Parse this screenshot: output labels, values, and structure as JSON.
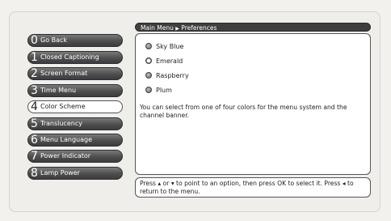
{
  "menu": {
    "items": [
      {
        "num": "0",
        "label": "Go Back",
        "selected": false
      },
      {
        "num": "1",
        "label": "Closed Captioning",
        "selected": false
      },
      {
        "num": "2",
        "label": "Screen Format",
        "selected": false
      },
      {
        "num": "3",
        "label": "Time Menu",
        "selected": false
      },
      {
        "num": "4",
        "label": "Color Scheme",
        "selected": true
      },
      {
        "num": "5",
        "label": "Translucency",
        "selected": false
      },
      {
        "num": "6",
        "label": "Menu Language",
        "selected": false
      },
      {
        "num": "7",
        "label": "Power Indicator",
        "selected": false
      },
      {
        "num": "8",
        "label": "Lamp Power",
        "selected": false
      }
    ]
  },
  "breadcrumb": {
    "root": "Main Menu",
    "separator": "▶",
    "current": "Preferences"
  },
  "options": [
    {
      "label": "Sky Blue",
      "selected": false
    },
    {
      "label": "Emerald",
      "selected": true
    },
    {
      "label": "Raspberry",
      "selected": false
    },
    {
      "label": "Plum",
      "selected": false
    }
  ],
  "description": "You can select from one of four colors for the menu system and the channel banner.",
  "help": {
    "part1": "Press ",
    "up": "▴",
    "or": " or ",
    "down": "▾",
    "part2": " to point to an option, then press OK to select it. Press ",
    "left": "◂",
    "part3": " to return to the menu."
  },
  "colors": {
    "background": "#f2f1ee",
    "menu_button": "#4e4e4e",
    "title_bar": "#3f3f3f"
  }
}
